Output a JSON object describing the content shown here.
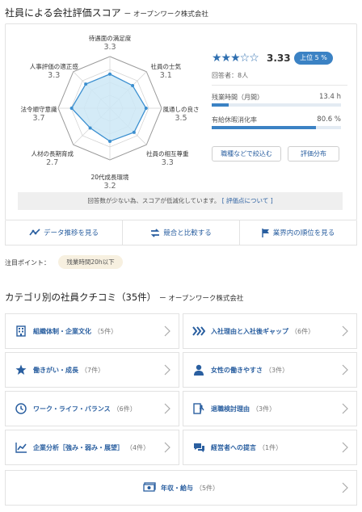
{
  "header": {
    "title": "社員による会社評価スコア",
    "company": "ー オープンワーク株式会社"
  },
  "radar": {
    "axes": [
      {
        "label": "待遇面の満足度",
        "value": 3.3
      },
      {
        "label": "社員の士気",
        "value": 3.1
      },
      {
        "label": "風通しの良さ",
        "value": 3.5
      },
      {
        "label": "社員の相互尊重",
        "value": 3.3
      },
      {
        "label": "20代成長環境",
        "value": 3.2
      },
      {
        "label": "人材の長期育成",
        "value": 2.7
      },
      {
        "label": "法令順守意識",
        "value": 3.7
      },
      {
        "label": "人事評価の適正感",
        "value": 3.3
      }
    ],
    "max": 5,
    "fill_color": "#cde7f6",
    "stroke_color": "#3b8fd0"
  },
  "summary": {
    "stars": "★★★☆☆",
    "score": "3.33",
    "rank_badge": "上位 5 %",
    "respondents": "回答者：8人",
    "stats": [
      {
        "label": "残業時間（月間）",
        "value": "13.4 h",
        "fill_fraction": 0.13
      },
      {
        "label": "有給休暇消化率",
        "value": "80.6 %",
        "fill_fraction": 0.806
      }
    ],
    "filter_button": "職種などで絞込む",
    "distribution_button": "評価分布"
  },
  "notice": {
    "text": "回答数が少ない為、スコアが低減化しています。",
    "link": "[ 評価点について ]"
  },
  "actions": [
    {
      "label": "データ推移を見る",
      "icon": "trend-icon"
    },
    {
      "label": "競合と比較する",
      "icon": "compare-icon"
    },
    {
      "label": "業界内の順位を見る",
      "icon": "flag-icon"
    }
  ],
  "focus": {
    "label": "注目ポイント：",
    "tag": "残業時間20h以下"
  },
  "reviews": {
    "title": "カテゴリ別の社員クチコミ（35件）",
    "company": "ー オープンワーク株式会社",
    "categories": [
      {
        "label": "組織体制・企業文化",
        "count": "（5件）",
        "icon": "building-icon"
      },
      {
        "label": "入社理由と入社後ギャップ",
        "count": "（6件）",
        "icon": "arrows-icon"
      },
      {
        "label": "働きがい・成長",
        "count": "（7件）",
        "icon": "star-icon"
      },
      {
        "label": "女性の働きやすさ",
        "count": "（3件）",
        "icon": "person-icon"
      },
      {
        "label": "ワーク・ライフ・バランス",
        "count": "（6件）",
        "icon": "clock-icon"
      },
      {
        "label": "退職検討理由",
        "count": "（3件）",
        "icon": "exit-icon"
      },
      {
        "label": "企業分析［強み・弱み・展望］",
        "count": "（4件）",
        "icon": "chart-icon"
      },
      {
        "label": "経営者への提言",
        "count": "（1件）",
        "icon": "chat-icon"
      }
    ],
    "wide": {
      "label": "年収・給与",
      "count": "（5件）",
      "icon": "money-icon"
    }
  }
}
